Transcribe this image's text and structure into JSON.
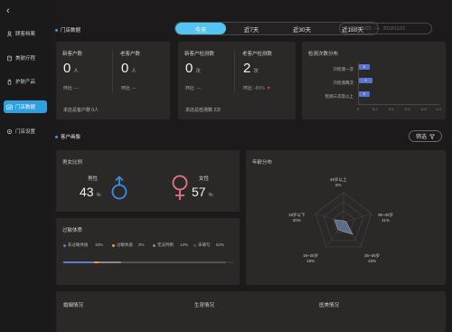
{
  "sidebar": {
    "back_icon": "chevron-left-icon",
    "items": [
      {
        "label": "顾客档案",
        "icon": "user-icon"
      },
      {
        "label": "美肤疗程",
        "icon": "skincare-icon"
      },
      {
        "label": "护肤产品",
        "icon": "product-icon"
      },
      {
        "label": "门店数据",
        "icon": "chart-icon",
        "active": true
      },
      {
        "label": "门店设置",
        "icon": "settings-icon"
      }
    ]
  },
  "store_section": {
    "title": "门店数据"
  },
  "tabs": [
    {
      "label": "今天",
      "active": true
    },
    {
      "label": "近7天"
    },
    {
      "label": "近30天"
    },
    {
      "label": "近180天"
    }
  ],
  "date_range": {
    "start": "2019/11/21",
    "separator": "—",
    "end": "2019/11/21"
  },
  "customer_card": {
    "new_label": "新客户数",
    "new_value": "0",
    "new_unit": "人",
    "new_ring_label": "环比",
    "new_ring_value": "—",
    "old_label": "老客户数",
    "old_value": "0",
    "old_unit": "人",
    "old_ring_label": "环比",
    "old_ring_value": "—",
    "footer": "本店总客户数 0人"
  },
  "detect_card": {
    "new_label": "新客户检测数",
    "new_value": "0",
    "new_unit": "次",
    "new_ring_label": "环比",
    "new_ring_value": "—",
    "old_label": "老客户检测数",
    "old_value": "2",
    "old_unit": "次",
    "old_ring_label": "环比",
    "old_ring_value": "-85%",
    "footer": "本店总检测数 2次",
    "down_color": "#e8453c"
  },
  "detect_dist": {
    "title": "检测次数分布",
    "rows": [
      {
        "label": "只检测一次",
        "value": "0"
      },
      {
        "label": "只检测两次",
        "value": "1"
      },
      {
        "label": "检测三次及以上",
        "value": "0"
      }
    ],
    "x_ticks": [
      "0",
      "0.2",
      "0.4",
      "0.6",
      "0.8",
      "1.0"
    ]
  },
  "portrait_section": {
    "title": "客户画像",
    "filter_label": "筛选",
    "filter_icon": "filter-icon"
  },
  "gender_card": {
    "title": "男女比例",
    "male_label": "男性",
    "male_value": "43",
    "male_unit": "%",
    "male_color": "#3a8ee6",
    "female_label": "女性",
    "female_value": "57",
    "female_unit": "%",
    "female_color": "#e77580"
  },
  "skin_card": {
    "title": "过敏体质",
    "items": [
      {
        "label": "非过敏体质",
        "value": "18%",
        "color": "#5b7bd5"
      },
      {
        "label": "过敏体质",
        "value": "3%",
        "color": "#e79a4a"
      },
      {
        "label": "无法判断",
        "value": "13%",
        "color": "#8a8785"
      },
      {
        "label": "未填写",
        "value": "62%",
        "color": "#55524f"
      }
    ]
  },
  "age_card": {
    "title": "年龄分布",
    "groups": [
      {
        "label": "45岁以上",
        "value": "5%"
      },
      {
        "label": "36~45岁",
        "value": "11%"
      },
      {
        "label": "26~35岁",
        "value": "43%"
      },
      {
        "label": "18~25岁",
        "value": "18%"
      },
      {
        "label": "18岁以下",
        "value": "20%"
      }
    ],
    "fill_color": "#6b7e9e"
  },
  "bottom_titles": {
    "marriage": "婚姻情况",
    "birth": "生育情况",
    "beauty": "医美情况"
  }
}
